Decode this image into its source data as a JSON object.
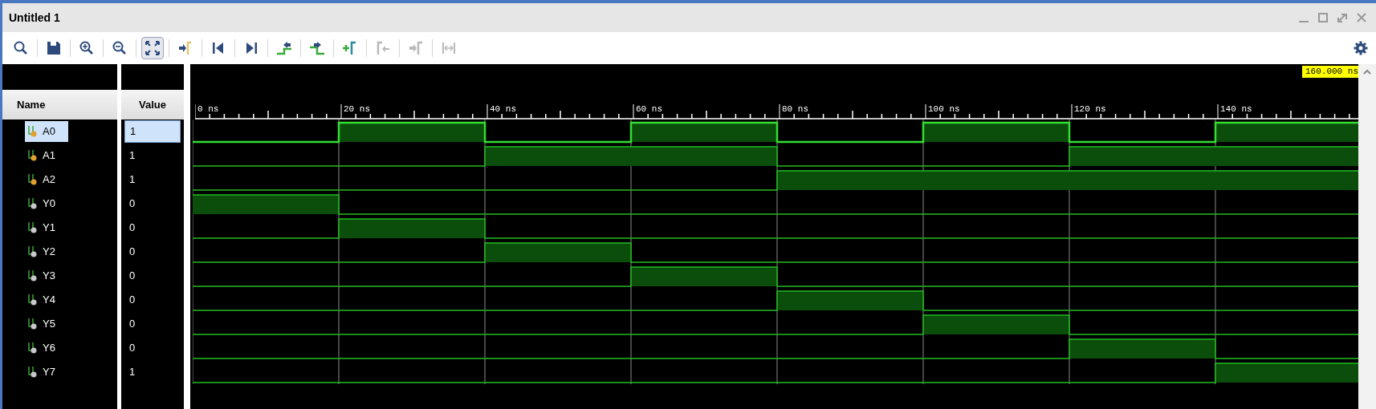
{
  "window": {
    "title": "Untitled 1"
  },
  "toolbar": [
    {
      "kind": "search",
      "pressed": false,
      "disabled": false
    },
    {
      "kind": "save",
      "pressed": false,
      "disabled": false
    },
    {
      "kind": "zoom-in",
      "pressed": false,
      "disabled": false
    },
    {
      "kind": "zoom-out",
      "pressed": false,
      "disabled": false
    },
    {
      "kind": "fit",
      "pressed": true,
      "disabled": false
    },
    {
      "kind": "go-cursor",
      "pressed": false,
      "disabled": false
    },
    {
      "kind": "go-start",
      "pressed": false,
      "disabled": false
    },
    {
      "kind": "go-end",
      "pressed": false,
      "disabled": false
    },
    {
      "kind": "prev-transition",
      "pressed": false,
      "disabled": false
    },
    {
      "kind": "next-transition",
      "pressed": false,
      "disabled": false
    },
    {
      "kind": "add-marker",
      "pressed": false,
      "disabled": false
    },
    {
      "kind": "prev-marker",
      "pressed": false,
      "disabled": true
    },
    {
      "kind": "next-marker",
      "pressed": false,
      "disabled": true
    },
    {
      "kind": "swap-markers",
      "pressed": false,
      "disabled": true
    }
  ],
  "timeline": {
    "ticks": [
      "0 ns",
      "20 ns",
      "40 ns",
      "60 ns",
      "80 ns",
      "100 ns",
      "120 ns",
      "140 ns"
    ],
    "cursor": "160.000 ns"
  },
  "columns": [
    "Name",
    "Value"
  ],
  "signals": [
    {
      "name": "A0",
      "value": "1",
      "kind": "input",
      "selected": true,
      "high": [
        false,
        true,
        false,
        true,
        false,
        true,
        false,
        true
      ]
    },
    {
      "name": "A1",
      "value": "1",
      "kind": "input",
      "selected": false,
      "high": [
        false,
        false,
        true,
        true,
        false,
        false,
        true,
        true
      ]
    },
    {
      "name": "A2",
      "value": "1",
      "kind": "input",
      "selected": false,
      "high": [
        false,
        false,
        false,
        false,
        true,
        true,
        true,
        true
      ]
    },
    {
      "name": "Y0",
      "value": "0",
      "kind": "output",
      "selected": false,
      "high": [
        true,
        false,
        false,
        false,
        false,
        false,
        false,
        false
      ]
    },
    {
      "name": "Y1",
      "value": "0",
      "kind": "output",
      "selected": false,
      "high": [
        false,
        true,
        false,
        false,
        false,
        false,
        false,
        false
      ]
    },
    {
      "name": "Y2",
      "value": "0",
      "kind": "output",
      "selected": false,
      "high": [
        false,
        false,
        true,
        false,
        false,
        false,
        false,
        false
      ]
    },
    {
      "name": "Y3",
      "value": "0",
      "kind": "output",
      "selected": false,
      "high": [
        false,
        false,
        false,
        true,
        false,
        false,
        false,
        false
      ]
    },
    {
      "name": "Y4",
      "value": "0",
      "kind": "output",
      "selected": false,
      "high": [
        false,
        false,
        false,
        false,
        true,
        false,
        false,
        false
      ]
    },
    {
      "name": "Y5",
      "value": "0",
      "kind": "output",
      "selected": false,
      "high": [
        false,
        false,
        false,
        false,
        false,
        true,
        false,
        false
      ]
    },
    {
      "name": "Y6",
      "value": "0",
      "kind": "output",
      "selected": false,
      "high": [
        false,
        false,
        false,
        false,
        false,
        false,
        true,
        false
      ]
    },
    {
      "name": "Y7",
      "value": "1",
      "kind": "output",
      "selected": false,
      "high": [
        false,
        false,
        false,
        false,
        false,
        false,
        false,
        true
      ]
    }
  ]
}
